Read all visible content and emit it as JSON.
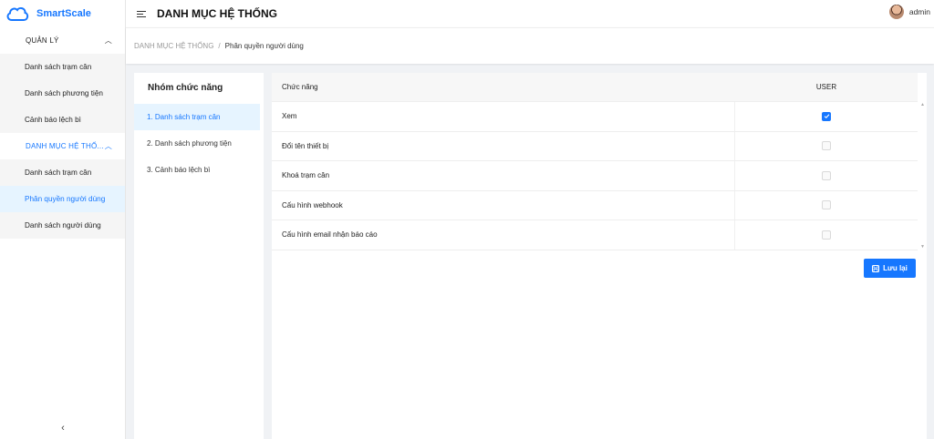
{
  "app": {
    "name": "SmartScale"
  },
  "header": {
    "title": "DANH MỤC HỆ THỐNG",
    "user": "admin"
  },
  "sidebar": {
    "groups": [
      {
        "label": "QUẢN LÝ",
        "items": [
          "Danh sách trạm cân",
          "Danh sách phương tiện",
          "Cảnh báo lệch bì"
        ]
      },
      {
        "label": "DANH MỤC HỆ THỐ...",
        "items": [
          "Danh sách trạm cân",
          "Phân quyền người dùng",
          "Danh sách người dùng"
        ]
      }
    ],
    "collapse_icon": "chevron-left-icon"
  },
  "breadcrumb": {
    "root": "DANH MỤC HỆ THỐNG",
    "separator": "/",
    "current": "Phân quyền người dùng"
  },
  "function_groups": {
    "title": "Nhóm chức năng",
    "items": [
      "1. Danh sách trạm cân",
      "2. Danh sách phương tiện",
      "3. Cảnh báo lệch bì"
    ]
  },
  "permissions": {
    "columns": {
      "function": "Chức năng",
      "role": "USER"
    },
    "rows": [
      {
        "function": "Xem",
        "checked": true
      },
      {
        "function": "Đổi tên thiết bị",
        "checked": false
      },
      {
        "function": "Khoá trạm cân",
        "checked": false
      },
      {
        "function": "Cấu hình webhook",
        "checked": false
      },
      {
        "function": "Cấu hình email nhận báo cáo",
        "checked": false
      }
    ],
    "save_label": "Lưu lại"
  },
  "colors": {
    "accent": "#1677ff",
    "selected_bg": "#e6f4ff"
  }
}
